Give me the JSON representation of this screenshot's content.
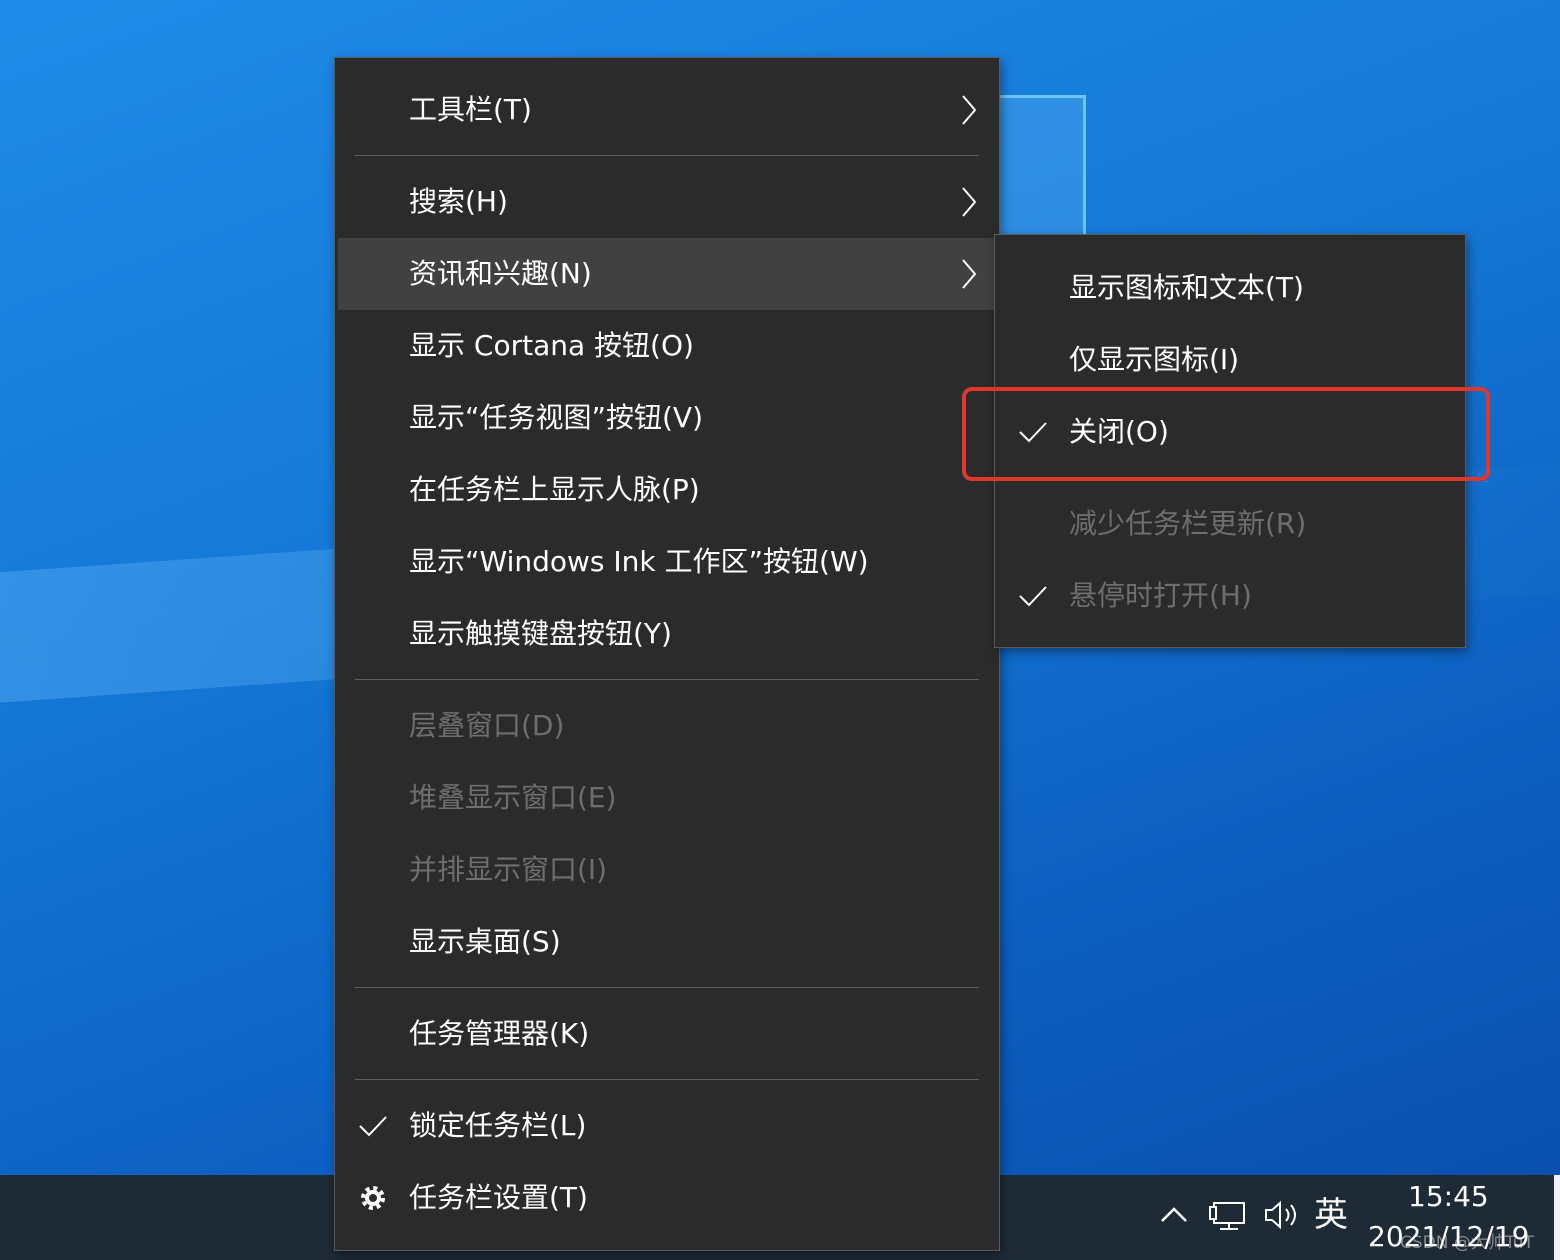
{
  "main_menu": {
    "toolbars": "工具栏(T)",
    "search": "搜索(H)",
    "news": "资讯和兴趣(N)",
    "cortana": "显示 Cortana 按钮(O)",
    "task_view": "显示“任务视图”按钮(V)",
    "people": "在任务栏上显示人脉(P)",
    "windows_ink": "显示“Windows Ink 工作区”按钮(W)",
    "touch_keyboard": "显示触摸键盘按钮(Y)",
    "cascade": "层叠窗口(D)",
    "stacked": "堆叠显示窗口(E)",
    "side_by_side": "并排显示窗口(I)",
    "show_desktop": "显示桌面(S)",
    "task_manager": "任务管理器(K)",
    "lock_taskbar": "锁定任务栏(L)",
    "taskbar_settings": "任务栏设置(T)"
  },
  "sub_menu": {
    "icon_and_text": "显示图标和文本(T)",
    "icon_only": "仅显示图标(I)",
    "turn_off": "关闭(O)",
    "reduce_updates": "减少任务栏更新(R)",
    "open_on_hover": "悬停时打开(H)"
  },
  "state": {
    "lock_taskbar_checked": true,
    "turn_off_checked": true,
    "open_on_hover_checked": true,
    "highlighted_item": "资讯和兴趣(N)"
  },
  "taskbar": {
    "ime": "英",
    "time": "15:45",
    "date": "2021/12/19",
    "watermark": "CSDN @大帅TuT"
  },
  "icons": [
    "chevron-right-icon",
    "checkmark-icon",
    "gear-icon",
    "chevron-up-icon",
    "network-icon",
    "volume-icon"
  ],
  "colors": {
    "menu_bg": "#2b2b2b",
    "highlight": "#414141",
    "disabled_text": "#6e6e6e",
    "annotation_box": "#e0362b"
  }
}
